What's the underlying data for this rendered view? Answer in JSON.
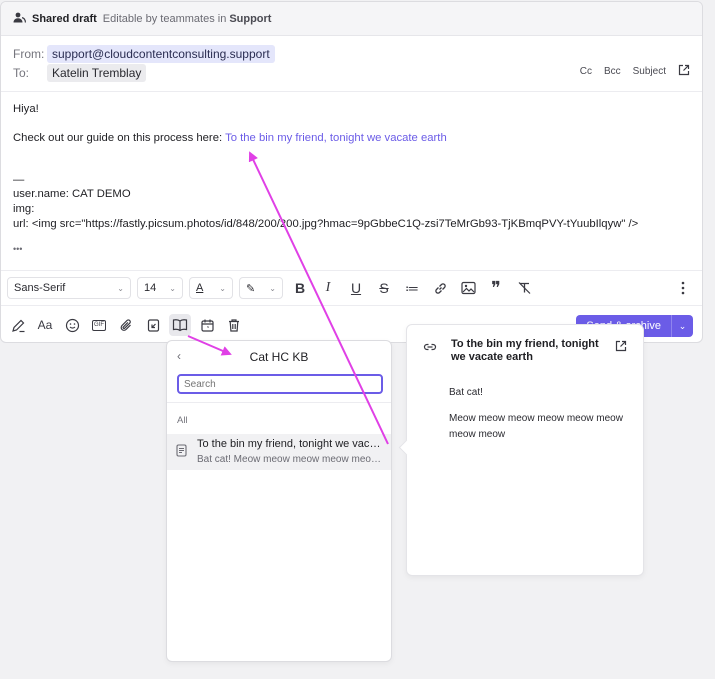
{
  "draft_bar": {
    "title": "Shared draft",
    "subtitle": "Editable by teammates in",
    "brand": "Support"
  },
  "headers": {
    "from_label": "From:",
    "from_value": "support@cloudcontentconsulting.support",
    "to_label": "To:",
    "to_value": "Katelin Tremblay",
    "cc": "Cc",
    "bcc": "Bcc",
    "subject": "Subject"
  },
  "body": {
    "greeting": "Hiya!",
    "guide_prefix": "Check out our guide on this process here: ",
    "guide_link": "To the bin my friend, tonight we vacate earth",
    "dash": "—",
    "user_name": "user.name: CAT DEMO",
    "img": "img:",
    "url": "url: <img src=\"https://fastly.picsum.photos/id/848/200/200.jpg?hmac=9pGbbeC1Q-zsi7TeMrGb93-TjKBmqPVY-tYuubIlqyw\" />",
    "ellipsis": "•••"
  },
  "format_bar": {
    "font": "Sans-Serif",
    "size": "14",
    "text_color_glyph": "A",
    "highlight_glyph": "✎",
    "bold": "B",
    "italic": "I",
    "underline": "U",
    "strike": "S",
    "list": "≔",
    "quote": "❞"
  },
  "action_bar": {
    "send_label": "Send & archive",
    "text_style_glyph": "Aa",
    "gif_label": "GIF"
  },
  "kb": {
    "title": "Cat HC KB",
    "search_placeholder": "Search",
    "section": "All",
    "item_title": "To the bin my friend, tonight we vacate earth",
    "item_snippet": "Bat cat! Meow meow meow meow meow meow meow meow"
  },
  "preview": {
    "title": "To the bin my friend, tonight we vacate earth",
    "para1": "Bat cat!",
    "para2": "Meow meow meow meow meow meow meow meow"
  },
  "colors": {
    "accent": "#6b5ce7",
    "annotation": "#e040e6"
  }
}
